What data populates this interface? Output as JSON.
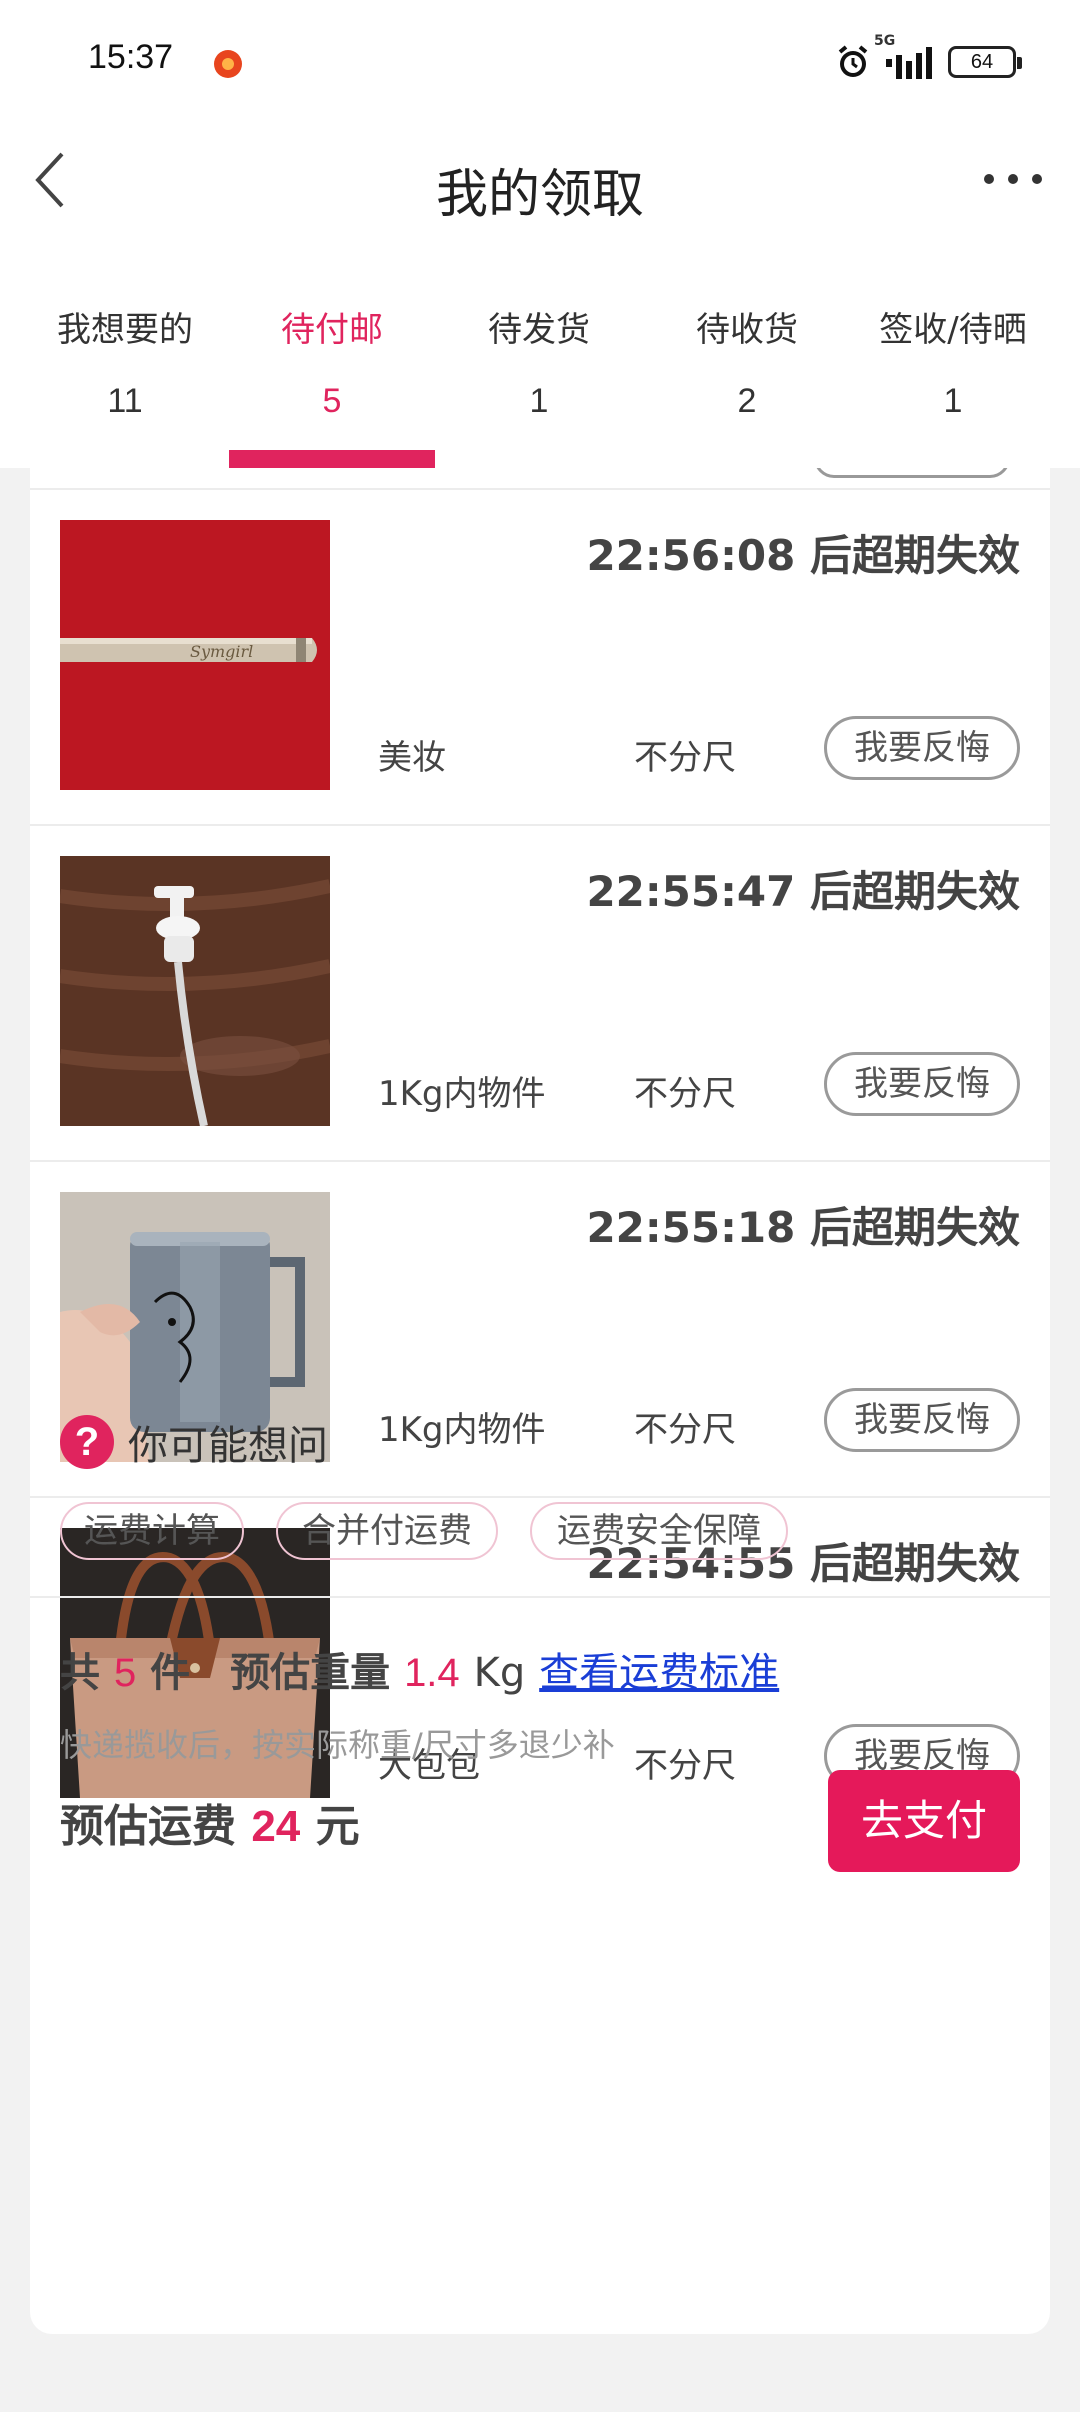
{
  "status_bar": {
    "time": "15:37",
    "network": "5G",
    "battery": "64"
  },
  "header": {
    "title": "我的领取"
  },
  "tabs": [
    {
      "label": "我想要的",
      "count": "11"
    },
    {
      "label": "待付邮",
      "count": "5"
    },
    {
      "label": "待发货",
      "count": "1"
    },
    {
      "label": "待收货",
      "count": "2"
    },
    {
      "label": "签收/待晒",
      "count": "1"
    }
  ],
  "active_tab": "待付邮",
  "items": [
    {
      "deadline": "22:56:08 后超期失效",
      "category": "美妆",
      "size": "不分尺",
      "action": "我要反悔",
      "image": "pen-on-red-cloth"
    },
    {
      "deadline": "22:55:47 后超期失效",
      "category": "1Kg内物件",
      "size": "不分尺",
      "action": "我要反悔",
      "image": "soap-pump-on-wood"
    },
    {
      "deadline": "22:55:18 后超期失效",
      "category": "1Kg内物件",
      "size": "不分尺",
      "action": "我要反悔",
      "image": "steel-mug-in-hand"
    },
    {
      "deadline": "22:54:55 后超期失效",
      "category": "大包包",
      "size": "不分尺",
      "action": "我要反悔",
      "image": "tan-tote-bag"
    }
  ],
  "faq": {
    "icon": "?",
    "title": "你可能想问",
    "chips": [
      "运费计算",
      "合并付运费",
      "运费安全保障"
    ]
  },
  "summary": {
    "total_prefix": "共",
    "total_count": "5",
    "total_unit": "件",
    "weight_label": "预估重量",
    "weight_value": "1.4",
    "weight_unit": "Kg",
    "link": "查看运费标准",
    "note": "快递揽收后，按实际称重/尺寸多退少补",
    "fee_label": "预估运费",
    "fee_value": "24",
    "fee_unit": "元",
    "pay_button": "去支付"
  },
  "colors": {
    "accent": "#e0245e",
    "link": "#1a3ed6",
    "pay_button": "#e5195a"
  }
}
